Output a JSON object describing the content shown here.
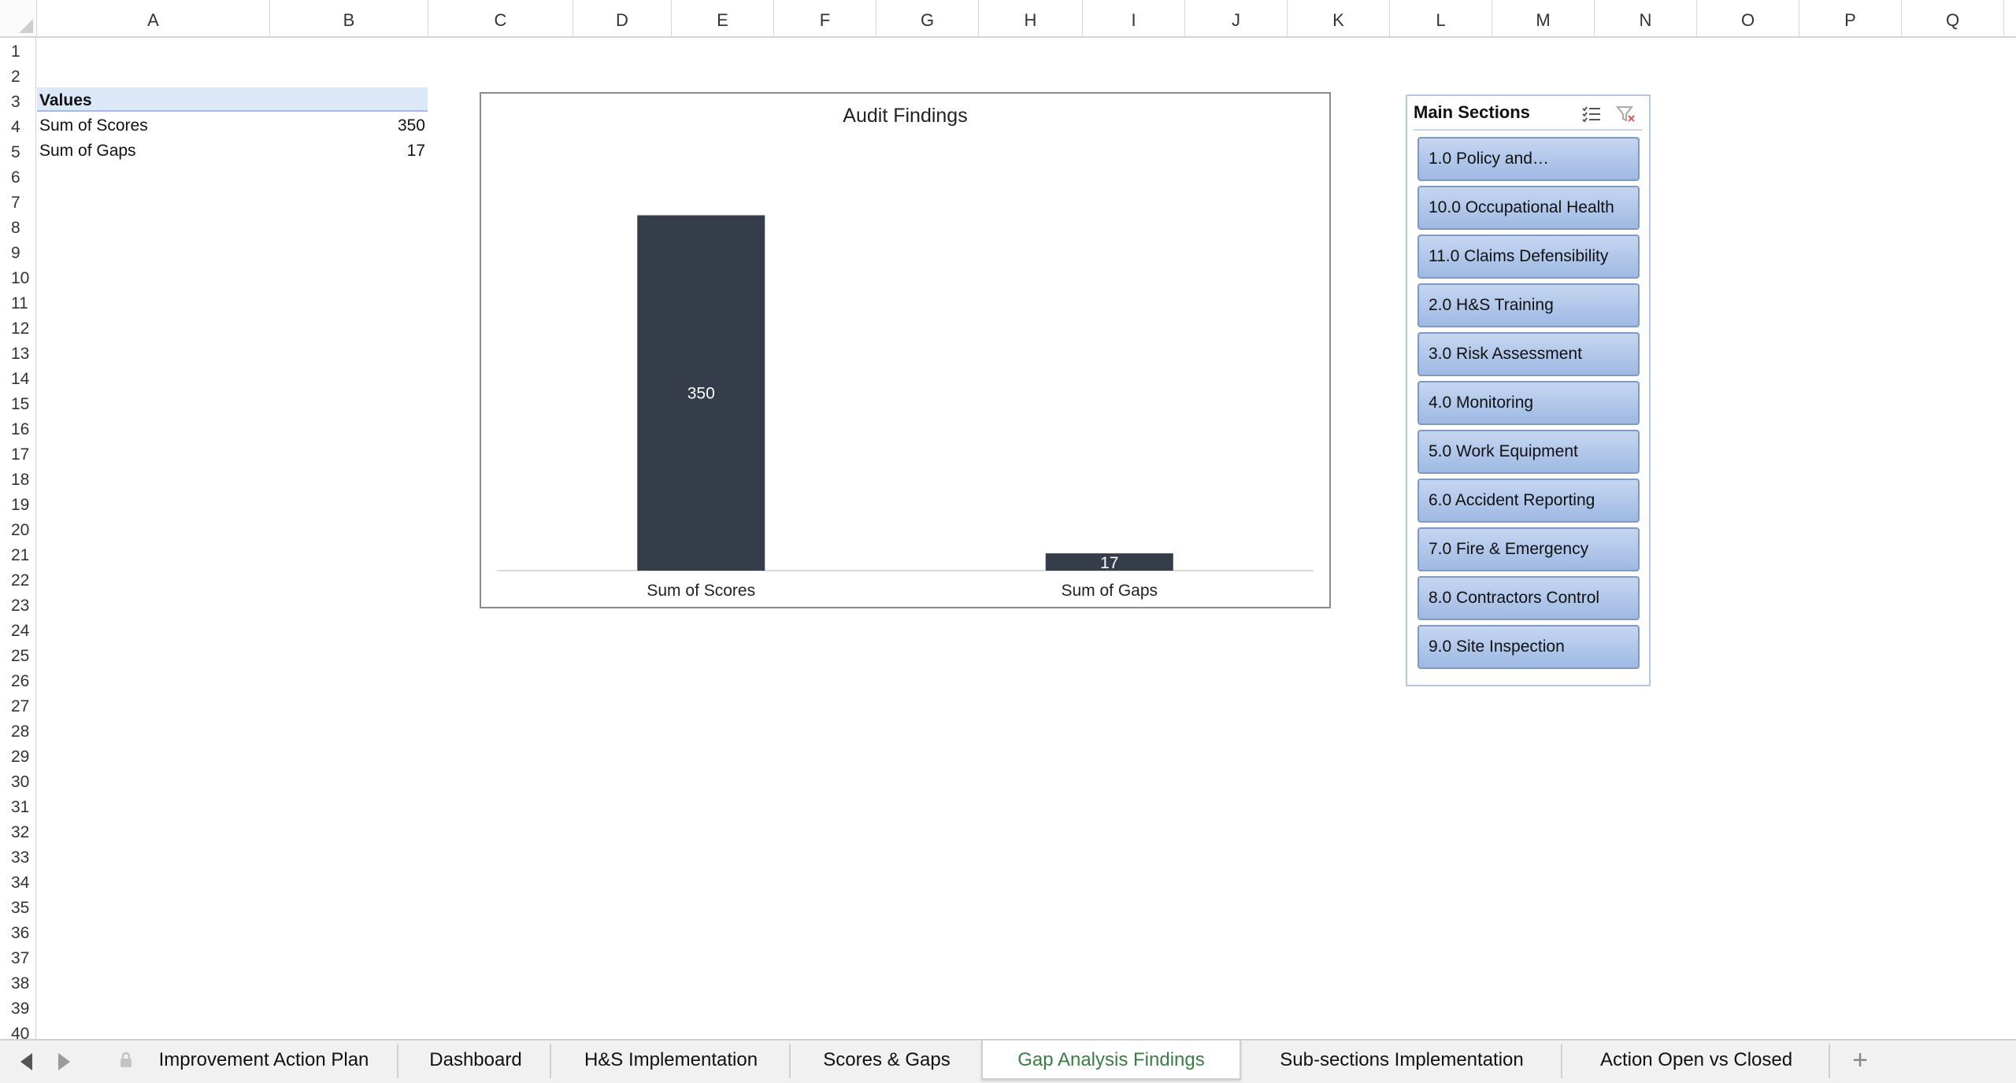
{
  "columns": [
    "A",
    "B",
    "C",
    "D",
    "E",
    "F",
    "G",
    "H",
    "I",
    "J",
    "K",
    "L",
    "M",
    "N",
    "O",
    "P",
    "Q"
  ],
  "rows": [
    "1",
    "2",
    "3",
    "4",
    "5",
    "6",
    "7",
    "8",
    "9",
    "10",
    "11",
    "12",
    "13",
    "14",
    "15",
    "16",
    "17",
    "18",
    "19",
    "20",
    "21",
    "22",
    "23",
    "24",
    "25",
    "26",
    "27",
    "28",
    "29",
    "30",
    "31",
    "32",
    "33",
    "34",
    "35",
    "36",
    "37",
    "38",
    "39",
    "40"
  ],
  "pivot": {
    "header": "Values",
    "rows": [
      {
        "label": "Sum of Scores",
        "value": "350"
      },
      {
        "label": "Sum of Gaps",
        "value": "17"
      }
    ]
  },
  "chart_data": {
    "type": "bar",
    "title": "Audit Findings",
    "categories": [
      "Sum of Scores",
      "Sum of Gaps"
    ],
    "values": [
      350,
      17
    ],
    "data_labels": [
      "350",
      "17"
    ],
    "ylim": [
      0,
      400
    ],
    "grid": false,
    "legend": "none",
    "bar_color": "#353d4b"
  },
  "slicer": {
    "title": "Main Sections",
    "icons": [
      "multi-select-icon",
      "clear-filter-icon"
    ],
    "items": [
      "1.0 Policy and…",
      "10.0 Occupational Health",
      "11.0 Claims Defensibility",
      "2.0 H&S Training",
      "3.0 Risk Assessment",
      "4.0 Monitoring",
      "5.0 Work Equipment",
      "6.0 Accident Reporting",
      "7.0 Fire & Emergency",
      "8.0 Contractors  Control",
      "9.0 Site Inspection"
    ]
  },
  "sheet_tabs": [
    {
      "label": "Improvement Action Plan",
      "locked": true,
      "active": false
    },
    {
      "label": "Dashboard",
      "locked": false,
      "active": false
    },
    {
      "label": "H&S Implementation",
      "locked": false,
      "active": false
    },
    {
      "label": "Scores & Gaps",
      "locked": false,
      "active": false
    },
    {
      "label": "Gap Analysis Findings",
      "locked": false,
      "active": true
    },
    {
      "label": "Sub-sections Implementation",
      "locked": false,
      "active": false
    },
    {
      "label": "Action Open vs Closed",
      "locked": false,
      "active": false
    }
  ],
  "add_sheet_label": "+",
  "colors": {
    "accent_tab": "#3a7d44",
    "slicer_button": "#b3c8ec",
    "pivot_header": "#dbe8f7"
  }
}
